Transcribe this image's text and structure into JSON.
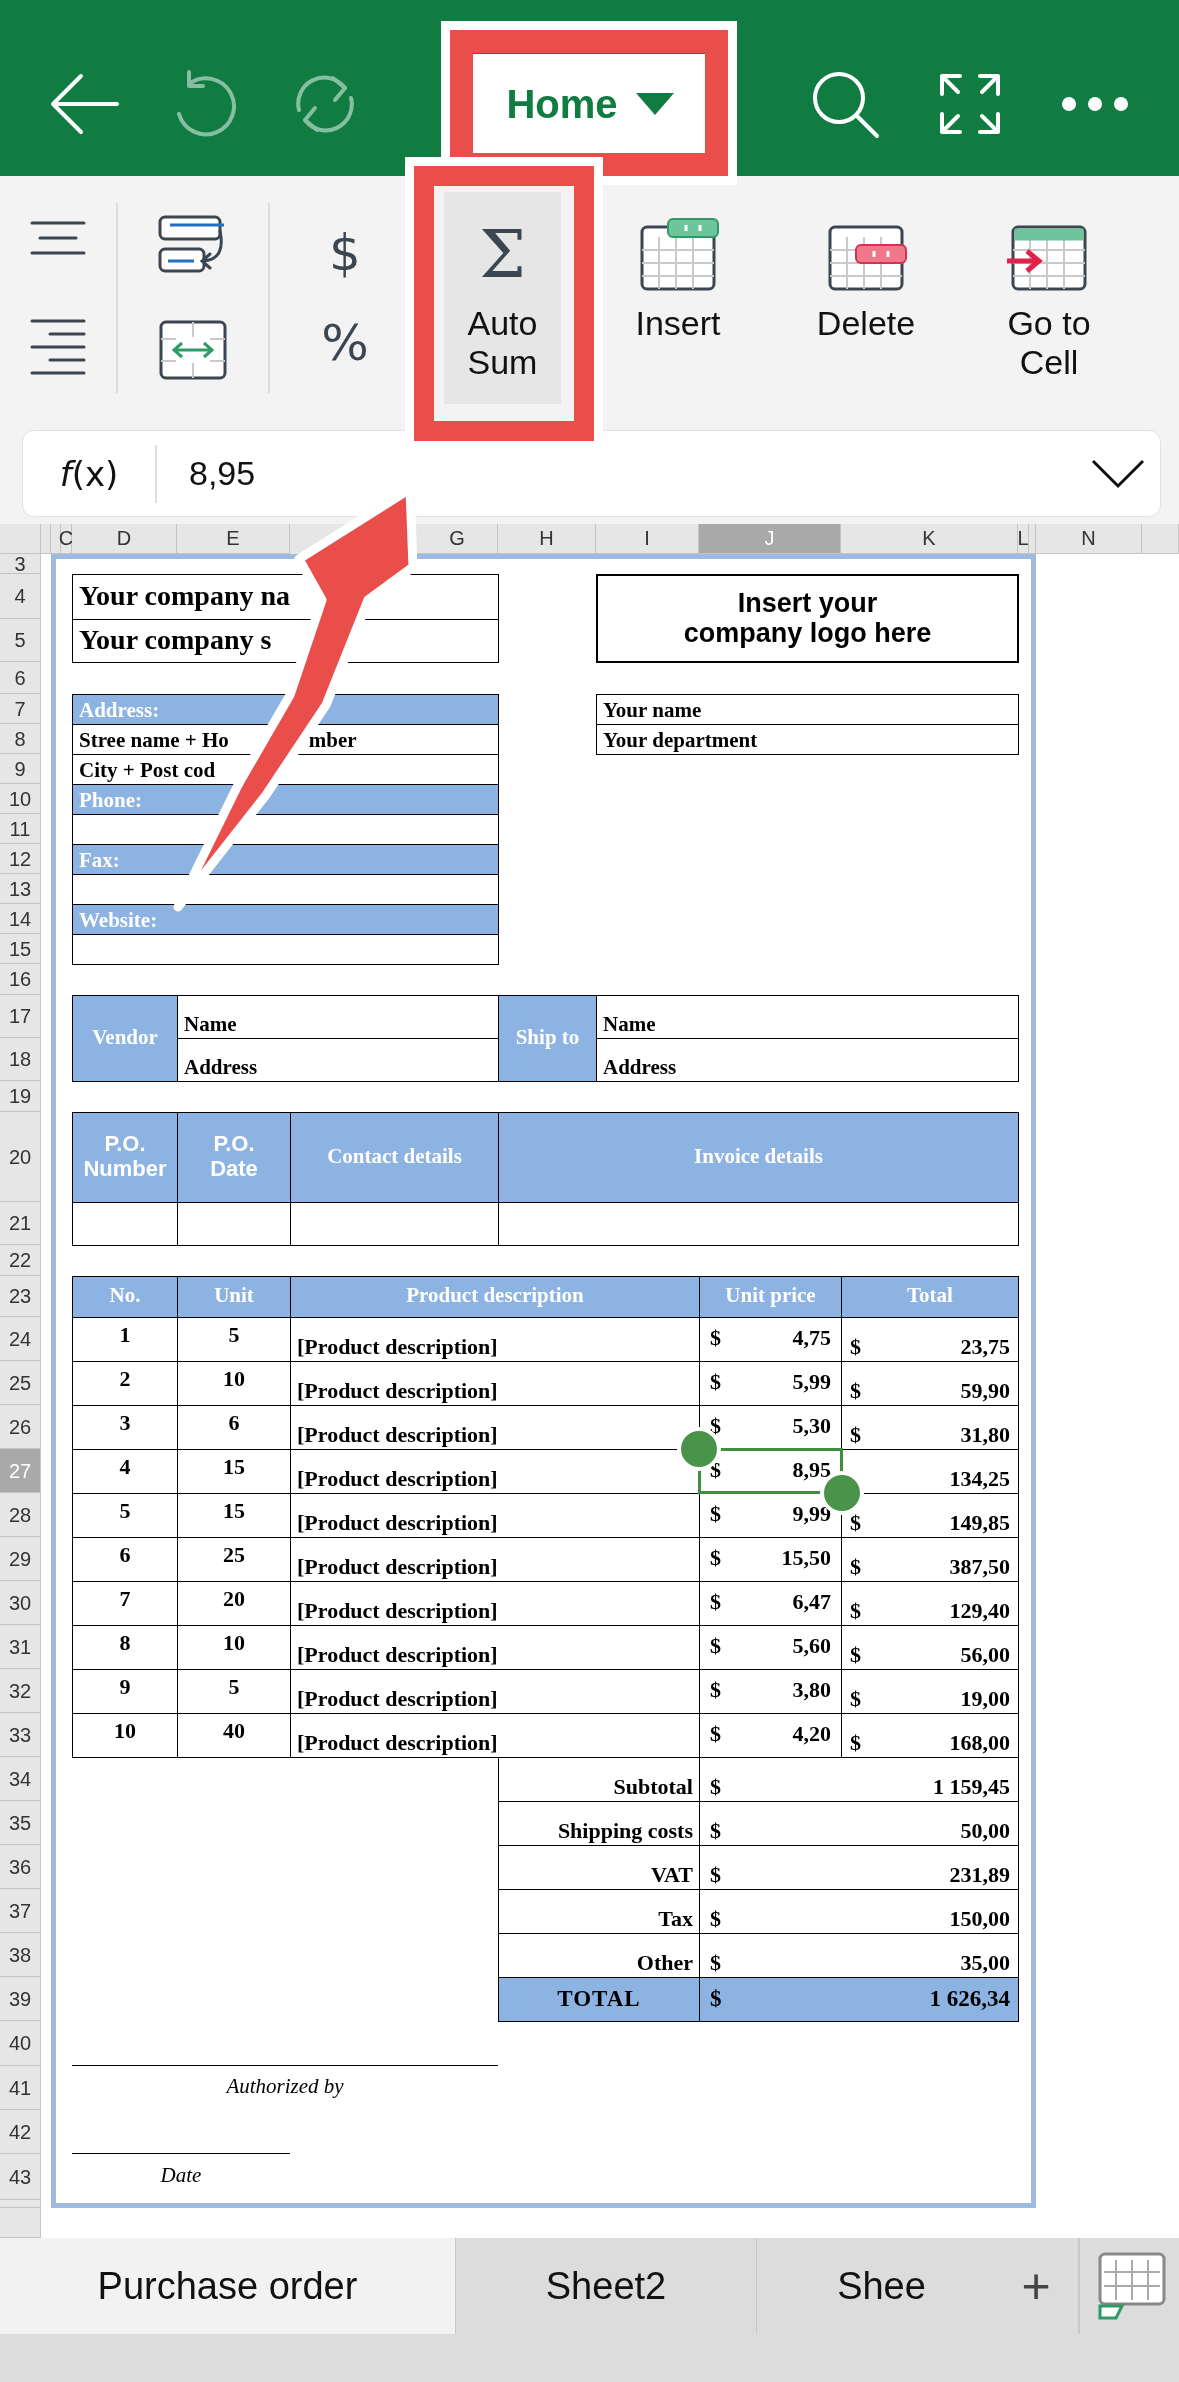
{
  "toolbar": {
    "title": "Home",
    "undo_disabled": true,
    "redo_disabled": true
  },
  "ribbon": {
    "symbols": [
      "$",
      "%"
    ],
    "commands": [
      {
        "label": "Auto Sum",
        "kind": "sum",
        "symbol": "Σ",
        "selected": true
      },
      {
        "label": "Insert",
        "kind": "insert",
        "selected": false
      },
      {
        "label": "Delete",
        "kind": "delete",
        "selected": false
      },
      {
        "label": "Go to Cell",
        "kind": "goto",
        "selected": false
      }
    ]
  },
  "formula_bar": {
    "function_label": "*f*(x)",
    "value": "8,95"
  },
  "columns": [
    {
      "selected": false
    },
    {
      "selected": false
    },
    {
      "label": "C",
      "selected": false
    },
    {
      "label": "D",
      "selected": false
    },
    {
      "label": "E",
      "selected": false
    },
    {
      "label": "G",
      "selected": false
    },
    {
      "label": "H",
      "selected": false
    },
    {
      "label": "I",
      "selected": false
    },
    {
      "label": "J",
      "selected": true
    },
    {
      "label": "K",
      "selected": false
    },
    {
      "label": "L",
      "selected": false
    },
    {
      "selected": false
    },
    {
      "label": "N",
      "selected": false
    },
    {
      "selected": false
    }
  ],
  "rows": [
    {
      "label": "3",
      "selected": false
    },
    {
      "label": "4",
      "selected": false
    },
    {
      "label": "5",
      "selected": false
    },
    {
      "label": "6",
      "selected": false
    },
    {
      "label": "7",
      "selected": false
    },
    {
      "label": "8",
      "selected": false
    },
    {
      "label": "9",
      "selected": false
    },
    {
      "label": "10",
      "selected": false
    },
    {
      "label": "11",
      "selected": false
    },
    {
      "label": "12",
      "selected": false
    },
    {
      "label": "13",
      "selected": false
    },
    {
      "label": "14",
      "selected": false
    },
    {
      "label": "15",
      "selected": false
    },
    {
      "label": "16",
      "selected": false
    },
    {
      "label": "17",
      "selected": false
    },
    {
      "label": "18",
      "selected": false
    },
    {
      "label": "19",
      "selected": false
    },
    {
      "label": "20",
      "selected": false
    },
    {
      "label": "21",
      "selected": false
    },
    {
      "label": "22",
      "selected": false
    },
    {
      "label": "23",
      "selected": false
    },
    {
      "label": "24",
      "selected": false
    },
    {
      "label": "25",
      "selected": false
    },
    {
      "label": "26",
      "selected": false
    },
    {
      "label": "27",
      "selected": true
    },
    {
      "label": "28",
      "selected": false
    },
    {
      "label": "29",
      "selected": false
    },
    {
      "label": "30",
      "selected": false
    },
    {
      "label": "31",
      "selected": false
    },
    {
      "label": "32",
      "selected": false
    },
    {
      "label": "33",
      "selected": false
    },
    {
      "label": "34",
      "selected": false
    },
    {
      "label": "35",
      "selected": false
    },
    {
      "label": "36",
      "selected": false
    },
    {
      "label": "37",
      "selected": false
    },
    {
      "label": "38",
      "selected": false
    },
    {
      "label": "39",
      "selected": false
    },
    {
      "label": "40",
      "selected": false
    },
    {
      "label": "41",
      "selected": false
    },
    {
      "label": "42",
      "selected": false
    },
    {
      "label": "43",
      "selected": false
    },
    {
      "selected": false
    },
    {
      "selected": false
    }
  ],
  "company": {
    "name": "Your company na",
    "slogan": "Your company s",
    "logo_text": "Insert your\ncompany logo here"
  },
  "address_block": [
    {
      "kind": "header",
      "parts": [
        "Address:"
      ]
    },
    {
      "kind": "value",
      "parts": [
        "Stree name + Ho",
        "mber"
      ]
    },
    {
      "kind": "value",
      "parts": [
        "City + Post cod"
      ]
    },
    {
      "kind": "header",
      "parts": [
        "Phone:"
      ]
    },
    {
      "kind": "value"
    },
    {
      "kind": "header",
      "parts": [
        "Fax:"
      ]
    },
    {
      "kind": "value"
    },
    {
      "kind": "header",
      "parts": [
        "Website:"
      ]
    },
    {
      "kind": "value"
    }
  ],
  "contact": [
    "Your name",
    "Your department"
  ],
  "parties": [
    {
      "label": "Vendor",
      "name": "Name",
      "address": "Address"
    },
    {
      "label": "Ship to",
      "name": "Name",
      "address": "Address"
    }
  ],
  "po_table": [
    {
      "label": "P.O. Number",
      "kind": "short"
    },
    {
      "label": "P.O. Date",
      "kind": "short"
    },
    {
      "label": "Contact details",
      "kind": "wide"
    },
    {
      "label": "Invoice details",
      "kind": "wide"
    }
  ],
  "items": {
    "columns": [
      "No.",
      "Unit",
      "Product description",
      "Unit price",
      "Total"
    ],
    "rows": [
      {
        "no": "1",
        "unit": "5",
        "description": "[Product description]",
        "price_currency": "$",
        "price": "4,75",
        "total_currency": "$",
        "total": "23,75"
      },
      {
        "no": "2",
        "unit": "10",
        "description": "[Product description]",
        "price_currency": "$",
        "price": "5,99",
        "total_currency": "$",
        "total": "59,90"
      },
      {
        "no": "3",
        "unit": "6",
        "description": "[Product description]",
        "price_currency": "$",
        "price": "5,30",
        "total_currency": "$",
        "total": "31,80"
      },
      {
        "no": "4",
        "unit": "15",
        "description": "[Product description]",
        "price_currency": "$",
        "price": "8,95",
        "total": "134,25"
      },
      {
        "no": "5",
        "unit": "15",
        "description": "[Product description]",
        "price_currency": "$",
        "price": "9,99",
        "total_currency": "$",
        "total": "149,85"
      },
      {
        "no": "6",
        "unit": "25",
        "description": "[Product description]",
        "price_currency": "$",
        "price": "15,50",
        "total_currency": "$",
        "total": "387,50"
      },
      {
        "no": "7",
        "unit": "20",
        "description": "[Product description]",
        "price_currency": "$",
        "price": "6,47",
        "total_currency": "$",
        "total": "129,40"
      },
      {
        "no": "8",
        "unit": "10",
        "description": "[Product description]",
        "price_currency": "$",
        "price": "5,60",
        "total_currency": "$",
        "total": "56,00"
      },
      {
        "no": "9",
        "unit": "5",
        "description": "[Product description]",
        "price_currency": "$",
        "price": "3,80",
        "total_currency": "$",
        "total": "19,00"
      },
      {
        "no": "10",
        "unit": "40",
        "description": "[Product description]",
        "price_currency": "$",
        "price": "4,20",
        "total_currency": "$",
        "total": "168,00"
      }
    ]
  },
  "summary": [
    {
      "label": "Subtotal",
      "currency": "$",
      "amount": "1 159,45",
      "kind": "line"
    },
    {
      "label": "Shipping costs",
      "currency": "$",
      "amount": "50,00",
      "kind": "line"
    },
    {
      "label": "VAT",
      "currency": "$",
      "amount": "231,89",
      "kind": "line"
    },
    {
      "label": "Tax",
      "currency": "$",
      "amount": "150,00",
      "kind": "line"
    },
    {
      "label": "Other",
      "currency": "$",
      "amount": "35,00",
      "kind": "line"
    },
    {
      "label": "TOTAL",
      "currency": "$",
      "amount": "1 626,34",
      "kind": "grand"
    }
  ],
  "signatures": [
    {
      "label": "Authorized by",
      "kind": "long"
    },
    {
      "label": "Date",
      "kind": "short"
    }
  ],
  "sheet_tabs": [
    {
      "label": "Purchase order",
      "selected": true
    },
    {
      "label": "Sheet2",
      "selected": false
    },
    {
      "label": "Shee",
      "selected": false
    }
  ],
  "add_sheet": "+"
}
